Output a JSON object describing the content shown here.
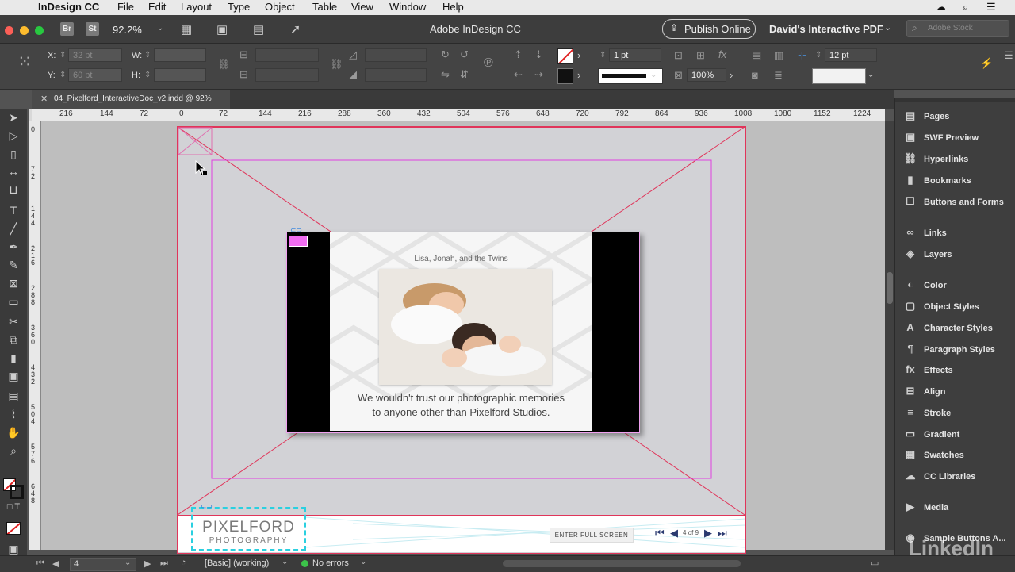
{
  "menubar": {
    "app_name": "InDesign CC",
    "items": [
      "File",
      "Edit",
      "Layout",
      "Type",
      "Object",
      "Table",
      "View",
      "Window",
      "Help"
    ]
  },
  "appbar": {
    "badges": [
      "Br",
      "St"
    ],
    "zoom": "92.2%",
    "title": "Adobe InDesign CC",
    "publish_label": "Publish Online",
    "workspace": "David's Interactive PDF",
    "search_placeholder": "Adobe Stock"
  },
  "controlbar": {
    "x_label": "X:",
    "y_label": "Y:",
    "x_value": "32 pt",
    "y_value": "60 pt",
    "w_label": "W:",
    "h_label": "H:",
    "stroke_weight": "1 pt",
    "opacity": "100%",
    "right_weight": "12 pt"
  },
  "document": {
    "tab_title": "04_Pixelford_InteractiveDoc_v2.indd @ 92%",
    "hruler": [
      "216",
      "144",
      "72",
      "0",
      "72",
      "144",
      "216",
      "288",
      "360",
      "432",
      "504",
      "576",
      "648",
      "720",
      "792",
      "864",
      "936",
      "1008",
      "1080",
      "1152",
      "1224"
    ],
    "vruler": [
      "0",
      "7 2",
      "1 4 4",
      "2 1 6",
      "2 8 8",
      "3 6 0",
      "4 3 2",
      "5 0 4",
      "5 7 6",
      "6 4 8"
    ]
  },
  "slide": {
    "caption": "Lisa, Jonah, and the Twins",
    "quote_line1": "We wouldn't trust our photographic memories",
    "quote_line2": "to anyone other than Pixelford Studios."
  },
  "footer": {
    "logo_line1": "PIXELFORD",
    "logo_line2": "PHOTOGRAPHY",
    "fullscreen_label": "ENTER FULL SCREEN",
    "page_counter": "4 of 9"
  },
  "panels": [
    {
      "label": "Pages",
      "icon": "pages-icon",
      "glyph": "▤"
    },
    {
      "label": "SWF Preview",
      "icon": "swf-preview-icon",
      "glyph": "▣"
    },
    {
      "label": "Hyperlinks",
      "icon": "hyperlinks-icon",
      "glyph": "⛓"
    },
    {
      "label": "Bookmarks",
      "icon": "bookmarks-icon",
      "glyph": "▮"
    },
    {
      "label": "Buttons and Forms",
      "icon": "buttons-forms-icon",
      "glyph": "☐"
    },
    {
      "label": "Links",
      "icon": "links-icon",
      "glyph": "∞"
    },
    {
      "label": "Layers",
      "icon": "layers-icon",
      "glyph": "◈"
    },
    {
      "label": "Color",
      "icon": "color-icon",
      "glyph": "◐"
    },
    {
      "label": "Object Styles",
      "icon": "object-styles-icon",
      "glyph": "▢"
    },
    {
      "label": "Character Styles",
      "icon": "character-styles-icon",
      "glyph": "A"
    },
    {
      "label": "Paragraph Styles",
      "icon": "paragraph-styles-icon",
      "glyph": "¶"
    },
    {
      "label": "Effects",
      "icon": "effects-icon",
      "glyph": "fx"
    },
    {
      "label": "Align",
      "icon": "align-icon",
      "glyph": "⊟"
    },
    {
      "label": "Stroke",
      "icon": "stroke-icon",
      "glyph": "≡"
    },
    {
      "label": "Gradient",
      "icon": "gradient-icon",
      "glyph": "▭"
    },
    {
      "label": "Swatches",
      "icon": "swatches-icon",
      "glyph": "▦"
    },
    {
      "label": "CC Libraries",
      "icon": "cc-libraries-icon",
      "glyph": "☁"
    },
    {
      "label": "Media",
      "icon": "media-icon",
      "glyph": "▶"
    },
    {
      "label": "Sample Buttons A...",
      "icon": "sample-buttons-icon",
      "glyph": "◉"
    }
  ],
  "statusbar": {
    "page_number": "4",
    "style": "[Basic] (working)",
    "errors": "No errors"
  },
  "watermark": "LinkedIn",
  "colors": {
    "frame_magenta": "#e040e0",
    "bleed_red": "#e0355a",
    "selection_cyan": "#2ad0e0"
  }
}
